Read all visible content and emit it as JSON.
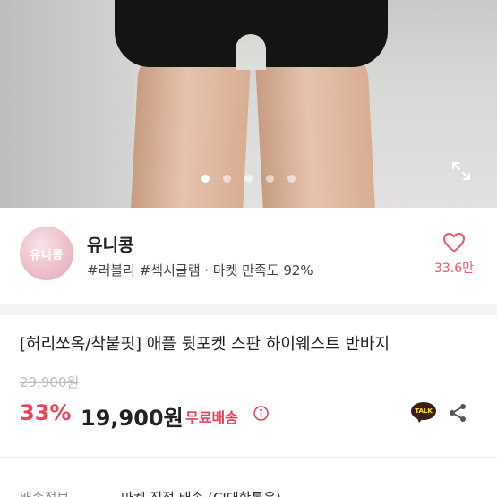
{
  "carousel": {
    "dot_count": 5,
    "active_index": 0
  },
  "shop": {
    "avatar_text": "유니콩",
    "name": "유니콩",
    "meta": "#러블리 #섹시글램 · 마켓 만족도 92%",
    "like_count": "33.6만"
  },
  "product": {
    "title": "[허리쏘옥/착붙핏] 애플 뒷포켓 스판 하이웨스트 반바지",
    "original_price": "29,900원",
    "discount": "33%",
    "price": "19,900원",
    "free_shipping": "무료배송",
    "talk_label": "TALK"
  },
  "delivery": {
    "label": "배송정보",
    "value": "마켓 직접 배송 (CJ대한통운)"
  },
  "colors": {
    "accent": "#f2405a",
    "like": "#e95c6b",
    "kakao_bg": "#3b1e1e",
    "kakao_text": "#fae100"
  },
  "icons": {
    "expand": "expand-icon",
    "heart": "heart-icon",
    "info": "info-icon",
    "share": "share-icon",
    "talk": "kakaotalk-icon"
  }
}
